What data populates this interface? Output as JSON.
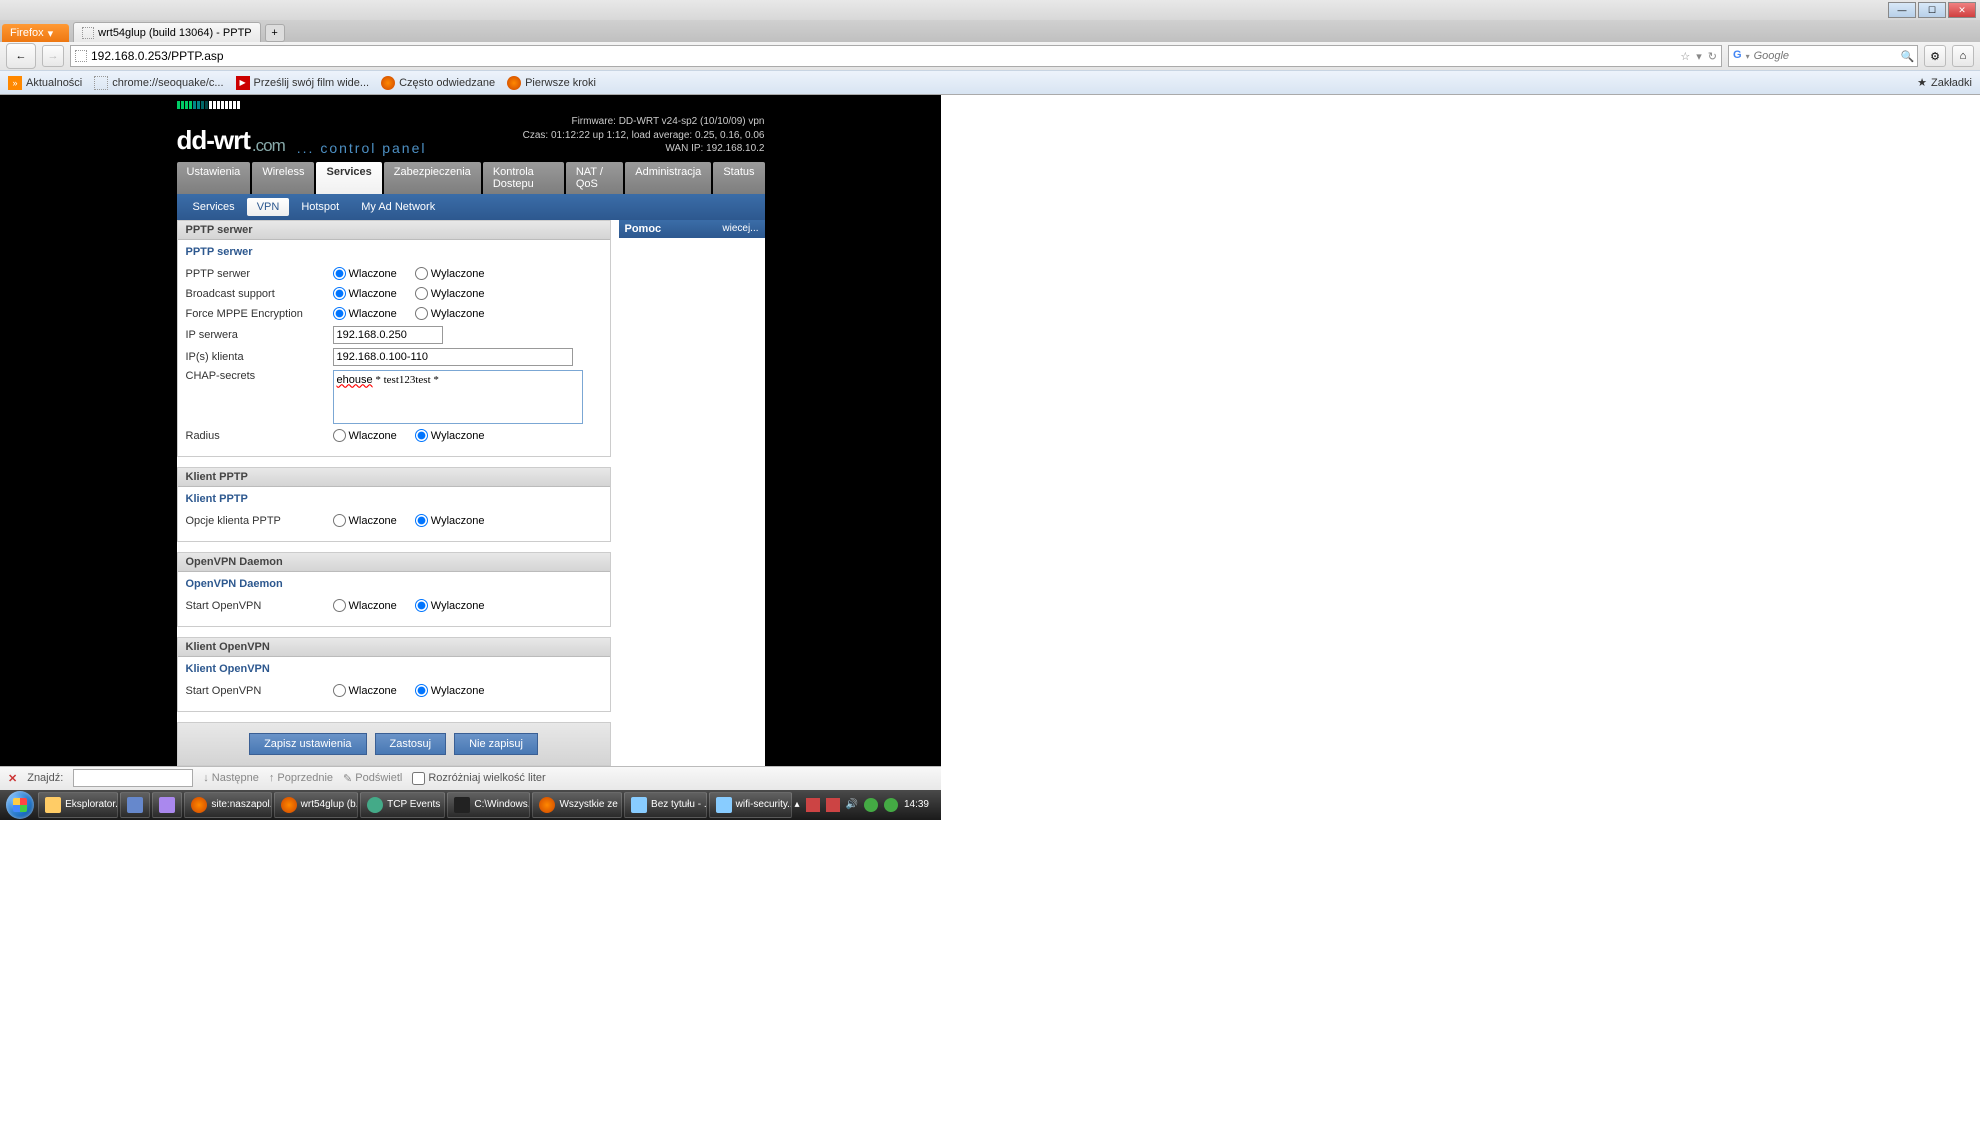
{
  "browser": {
    "app_button": "Firefox",
    "tab_title": "wrt54glup (build 13064) - PPTP",
    "url": "192.168.0.253/PPTP.asp",
    "search_placeholder": "Google",
    "bookmarks_label": "Zakładki",
    "bookmarks": [
      "Aktualności",
      "chrome://seoquake/c...",
      "Prześlij swój film wide...",
      "Często odwiedzane",
      "Pierwsze kroki"
    ]
  },
  "ddwrt": {
    "logo_main": "dd-wrt",
    "logo_suffix": ".com",
    "control_panel": "... control panel",
    "firmware": "Firmware: DD-WRT v24-sp2 (10/10/09) vpn",
    "czas": "Czas: 01:12:22 up 1:12, load average: 0.25, 0.16, 0.06",
    "wanip": "WAN IP: 192.168.10.2",
    "main_tabs": [
      "Ustawienia",
      "Wireless",
      "Services",
      "Zabezpieczenia",
      "Kontrola Dostepu",
      "NAT / QoS",
      "Administracja",
      "Status"
    ],
    "main_active": 2,
    "sub_tabs": [
      "Services",
      "VPN",
      "Hotspot",
      "My Ad Network"
    ],
    "sub_active": 1,
    "help_title": "Pomoc",
    "help_more": "wiecej...",
    "radio_on": "Wlaczone",
    "radio_off": "Wylaczone"
  },
  "sections": {
    "pptp_server": {
      "title": "PPTP serwer",
      "subtitle": "PPTP serwer",
      "rows": {
        "server": {
          "label": "PPTP serwer",
          "value": "on"
        },
        "broadcast": {
          "label": "Broadcast support",
          "value": "on"
        },
        "mppe": {
          "label": "Force MPPE Encryption",
          "value": "on"
        },
        "ip_server": {
          "label": "IP serwera",
          "value": "192.168.0.250"
        },
        "ip_client": {
          "label": "IP(s) klienta",
          "value": "192.168.0.100-110"
        },
        "chap": {
          "label": "CHAP-secrets",
          "value": "ehouse * test123test *"
        },
        "radius": {
          "label": "Radius",
          "value": "off"
        }
      }
    },
    "pptp_client": {
      "title": "Klient PPTP",
      "subtitle": "Klient PPTP",
      "row": {
        "label": "Opcje klienta PPTP",
        "value": "off"
      }
    },
    "openvpn_daemon": {
      "title": "OpenVPN Daemon",
      "subtitle": "OpenVPN Daemon",
      "row": {
        "label": "Start OpenVPN",
        "value": "off"
      }
    },
    "openvpn_client": {
      "title": "Klient OpenVPN",
      "subtitle": "Klient OpenVPN",
      "row": {
        "label": "Start OpenVPN",
        "value": "off"
      }
    }
  },
  "buttons": {
    "save": "Zapisz ustawienia",
    "apply": "Zastosuj",
    "cancel": "Nie zapisuj"
  },
  "findbar": {
    "label": "Znajdź:",
    "next": "Następne",
    "prev": "Poprzednie",
    "highlight": "Podświetl",
    "matchcase": "Rozróżniaj wielkość liter"
  },
  "taskbar": {
    "items": [
      "Eksplorator...",
      "",
      "",
      "site:naszapol...",
      "wrt54glup (b...",
      "TCP Events ...",
      "C:\\Windows...",
      "Wszystkie ze ...",
      "Bez tytułu - ...",
      "wifi-security...."
    ],
    "clock": "14:39"
  }
}
